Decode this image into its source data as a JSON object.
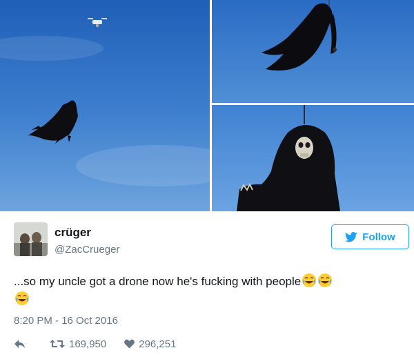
{
  "photos": [
    {
      "name": "drone-with-reaper-wide"
    },
    {
      "name": "reaper-closeup-flying"
    },
    {
      "name": "reaper-skull-closeup"
    }
  ],
  "user": {
    "display_name": "crüger",
    "handle": "@ZacCrueger"
  },
  "follow_label": "Follow",
  "tweet": {
    "text": "...so my uncle got a drone now he's fucking with people",
    "emojis": [
      "face-with-tears-of-joy",
      "face-with-tears-of-joy",
      "face-with-tears-of-joy"
    ]
  },
  "timestamp": "8:20 PM - 16 Oct 2016",
  "actions": {
    "retweets": "169,950",
    "likes": "296,251"
  },
  "colors": {
    "accent": "#1da1f2",
    "muted": "#657786",
    "text": "#14171a",
    "sky": "#2f6fc0"
  },
  "icons": {
    "follow": "twitter-bird-icon",
    "reply": "reply-icon",
    "retweet": "retweet-icon",
    "like": "heart-icon"
  }
}
